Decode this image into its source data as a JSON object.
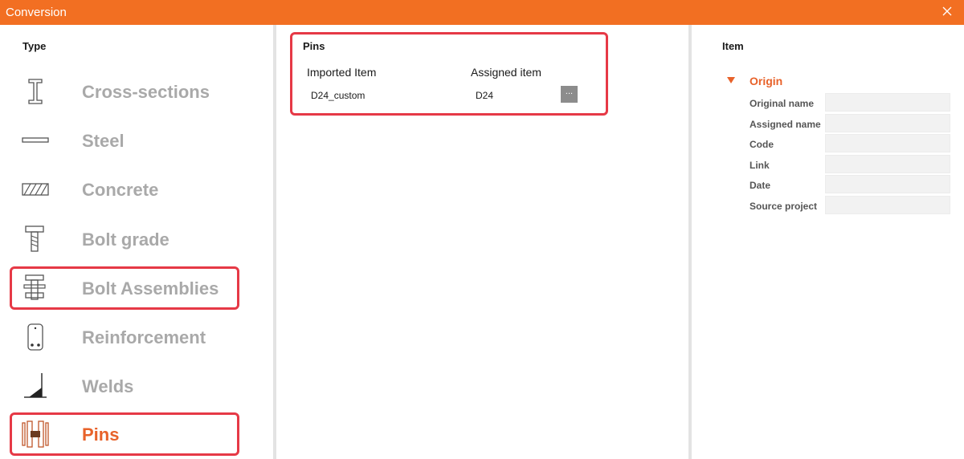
{
  "window": {
    "title": "Conversion",
    "close_icon": "close-icon"
  },
  "type_panel": {
    "heading": "Type",
    "items": [
      {
        "label": "Cross-sections",
        "icon": "cross-section-icon",
        "active": false,
        "highlighted": false
      },
      {
        "label": "Steel",
        "icon": "steel-icon",
        "active": false,
        "highlighted": false
      },
      {
        "label": "Concrete",
        "icon": "concrete-icon",
        "active": false,
        "highlighted": false
      },
      {
        "label": "Bolt grade",
        "icon": "bolt-grade-icon",
        "active": false,
        "highlighted": false
      },
      {
        "label": "Bolt Assemblies",
        "icon": "bolt-assembly-icon",
        "active": false,
        "highlighted": true
      },
      {
        "label": "Reinforcement",
        "icon": "reinforcement-icon",
        "active": false,
        "highlighted": false
      },
      {
        "label": "Welds",
        "icon": "weld-icon",
        "active": false,
        "highlighted": false
      },
      {
        "label": "Pins",
        "icon": "pin-icon",
        "active": true,
        "highlighted": true
      }
    ]
  },
  "pins_panel": {
    "heading": "Pins",
    "columns": {
      "imported": "Imported Item",
      "assigned": "Assigned item"
    },
    "rows": [
      {
        "imported": "D24_custom",
        "assigned": "D24",
        "button": "..."
      }
    ]
  },
  "item_panel": {
    "heading": "Item",
    "group": "Origin",
    "fields": [
      {
        "label": "Original name",
        "value": ""
      },
      {
        "label": "Assigned name",
        "value": ""
      },
      {
        "label": "Code",
        "value": ""
      },
      {
        "label": "Link",
        "value": ""
      },
      {
        "label": "Date",
        "value": ""
      },
      {
        "label": "Source project",
        "value": ""
      }
    ]
  },
  "colors": {
    "accent": "#f26f22",
    "active_text": "#e8622a",
    "highlight": "#e63946",
    "inactive_text": "#a9a9a9"
  }
}
